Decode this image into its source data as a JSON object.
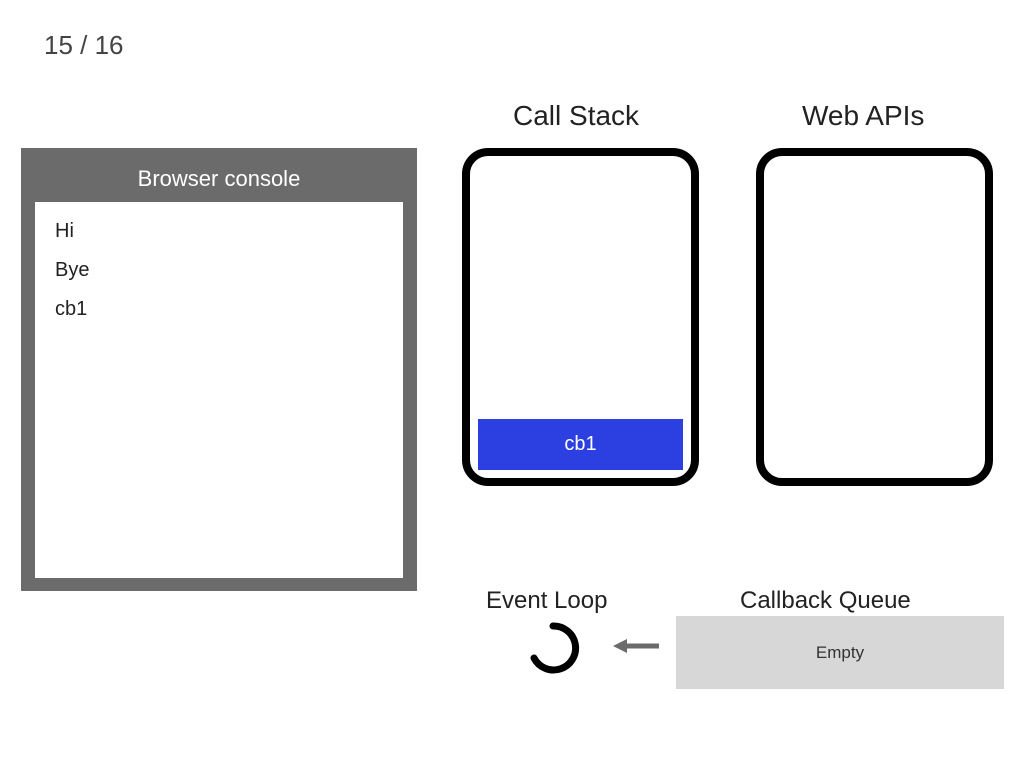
{
  "page_counter": "15 / 16",
  "console": {
    "title": "Browser console",
    "lines": [
      "Hi",
      "Bye",
      "cb1"
    ]
  },
  "headings": {
    "call_stack": "Call Stack",
    "web_apis": "Web APIs",
    "event_loop": "Event Loop",
    "callback_queue": "Callback Queue"
  },
  "call_stack": {
    "frames": [
      "cb1"
    ]
  },
  "web_apis": {
    "items": []
  },
  "callback_queue": {
    "content": "Empty"
  },
  "colors": {
    "stack_frame_bg": "#2c3fe0",
    "console_panel_bg": "#6b6b6b",
    "callback_queue_bg": "#d7d7d7"
  }
}
